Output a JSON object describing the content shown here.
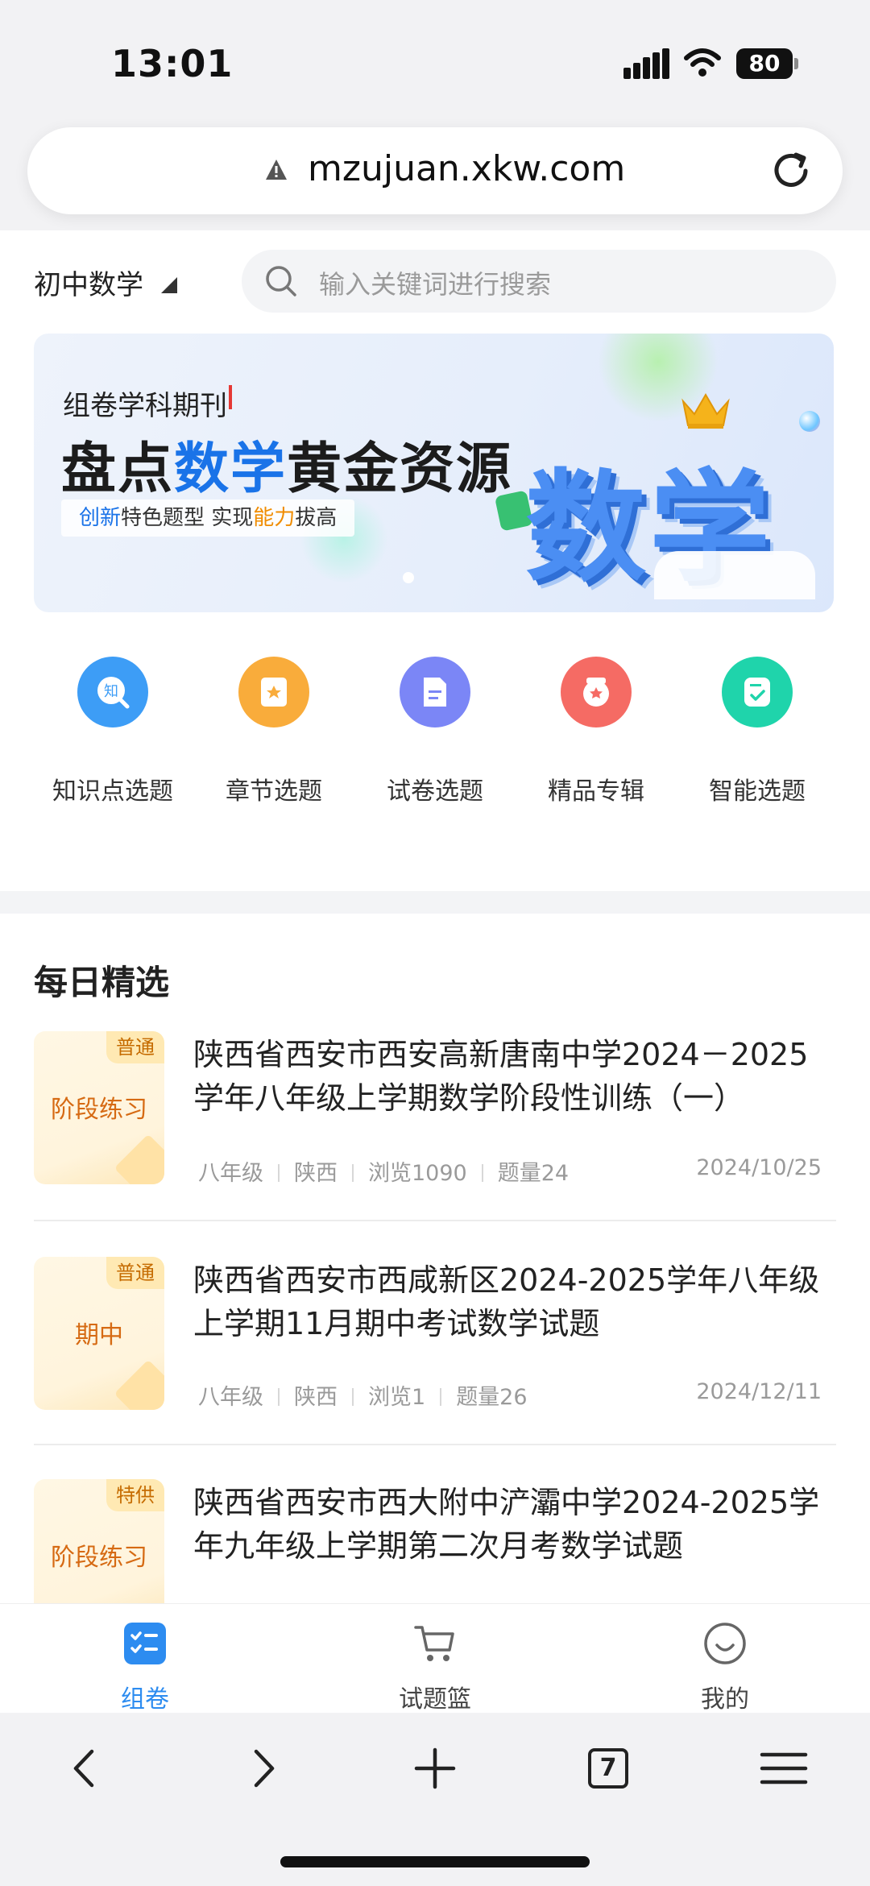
{
  "status": {
    "time": "13:01",
    "battery": "80"
  },
  "browser": {
    "url": "mzujuan.xkw.com",
    "tabs_count": "7"
  },
  "header": {
    "subject": "初中数学",
    "search_placeholder": "输入关键词进行搜索"
  },
  "banner": {
    "eyebrow": "组卷学科期刊",
    "title_a": "盘点",
    "title_hl": "数学",
    "title_b": "黄金资源",
    "tag_a": "创新",
    "tag_b": "特色题型  实现",
    "tag_c": "能力",
    "tag_d": "拔高",
    "big_text": "数学"
  },
  "shortcuts": [
    {
      "label": "知识点选题",
      "icon": "knowledge-icon",
      "color": "#3d9df6"
    },
    {
      "label": "章节选题",
      "icon": "chapter-icon",
      "color": "#f9ac3b"
    },
    {
      "label": "试卷选题",
      "icon": "paper-icon",
      "color": "#7b86f6"
    },
    {
      "label": "精品专辑",
      "icon": "album-icon",
      "color": "#f56b64"
    },
    {
      "label": "智能选题",
      "icon": "smart-icon",
      "color": "#1fd4ab"
    }
  ],
  "section": {
    "title": "每日精选"
  },
  "items": [
    {
      "badge": "普通",
      "type": "阶段练习",
      "title": "陕西省西安市西安高新唐南中学2024－2025学年八年级上学期数学阶段性训练（一）",
      "grade": "八年级",
      "region": "陕西",
      "views": "浏览1090",
      "count": "题量24",
      "date": "2024/10/25"
    },
    {
      "badge": "普通",
      "type": "期中",
      "title": "陕西省西安市西咸新区2024-2025学年八年级上学期11月期中考试数学试题",
      "grade": "八年级",
      "region": "陕西",
      "views": "浏览1",
      "count": "题量26",
      "date": "2024/12/11"
    },
    {
      "badge": "特供",
      "type": "阶段练习",
      "title": "陕西省西安市西大附中浐灞中学2024-2025学年九年级上学期第二次月考数学试题"
    }
  ],
  "tabbar": [
    {
      "label": "组卷",
      "icon": "compose-icon",
      "active": true
    },
    {
      "label": "试题篮",
      "icon": "cart-icon",
      "active": false
    },
    {
      "label": "我的",
      "icon": "profile-icon",
      "active": false
    }
  ],
  "colors": {
    "accent": "#2d8cf0",
    "badge_text": "#c56b00",
    "type_text": "#d66a13"
  }
}
